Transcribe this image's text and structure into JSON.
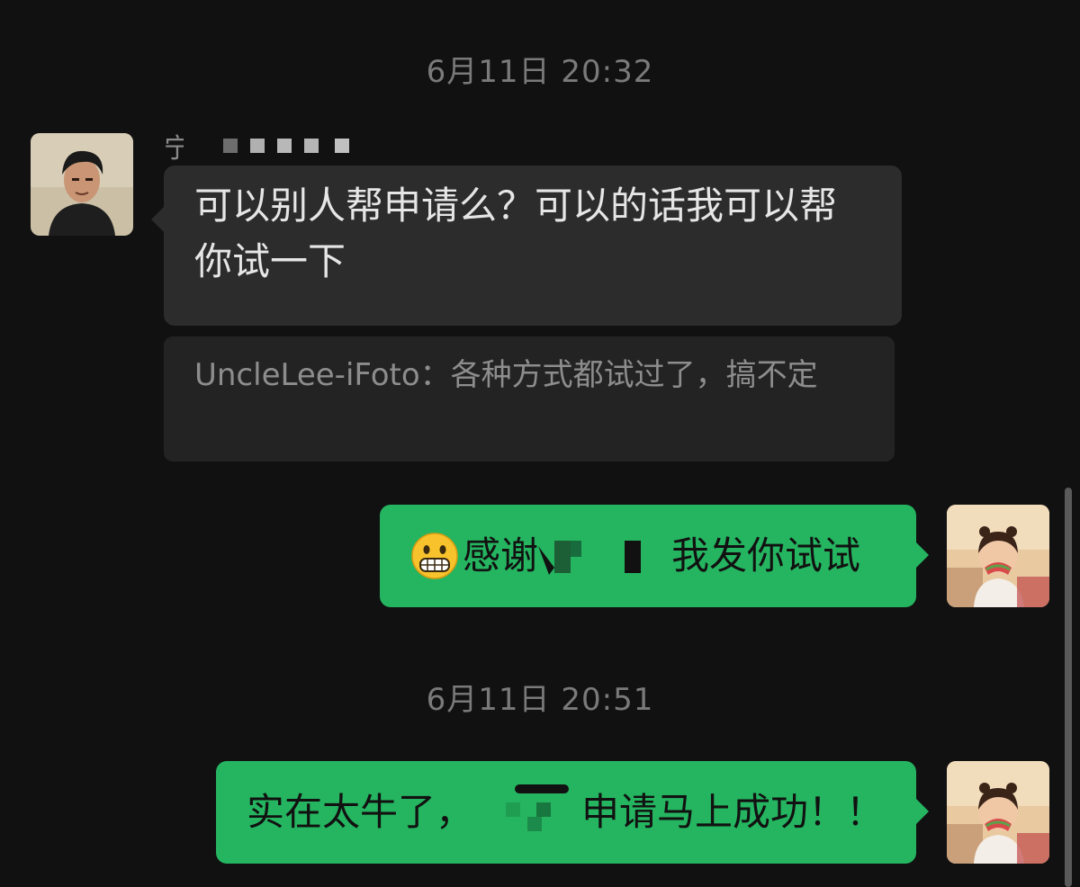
{
  "chat": {
    "timestamps": [
      "6月11日 20:32",
      "6月11日 20:51"
    ],
    "incoming": {
      "sender_name_visible": "宁",
      "message": "可以别人帮申请么？可以的话我可以帮你试一下",
      "quote": "UncleLee-iFoto：各种方式都试过了，搞不定"
    },
    "outgoing": [
      {
        "emoji": "grimacing-face",
        "text_before_redaction": "感谢",
        "text_after_redaction": "我发你试试"
      },
      {
        "text_before_redaction": "实在太牛了，",
        "text_after_redaction": "申请马上成功！！"
      }
    ]
  },
  "colors": {
    "background": "#111111",
    "incoming_bubble": "#2c2c2c",
    "outgoing_bubble": "#25b560",
    "timestamp_text": "#7a7a7a"
  }
}
